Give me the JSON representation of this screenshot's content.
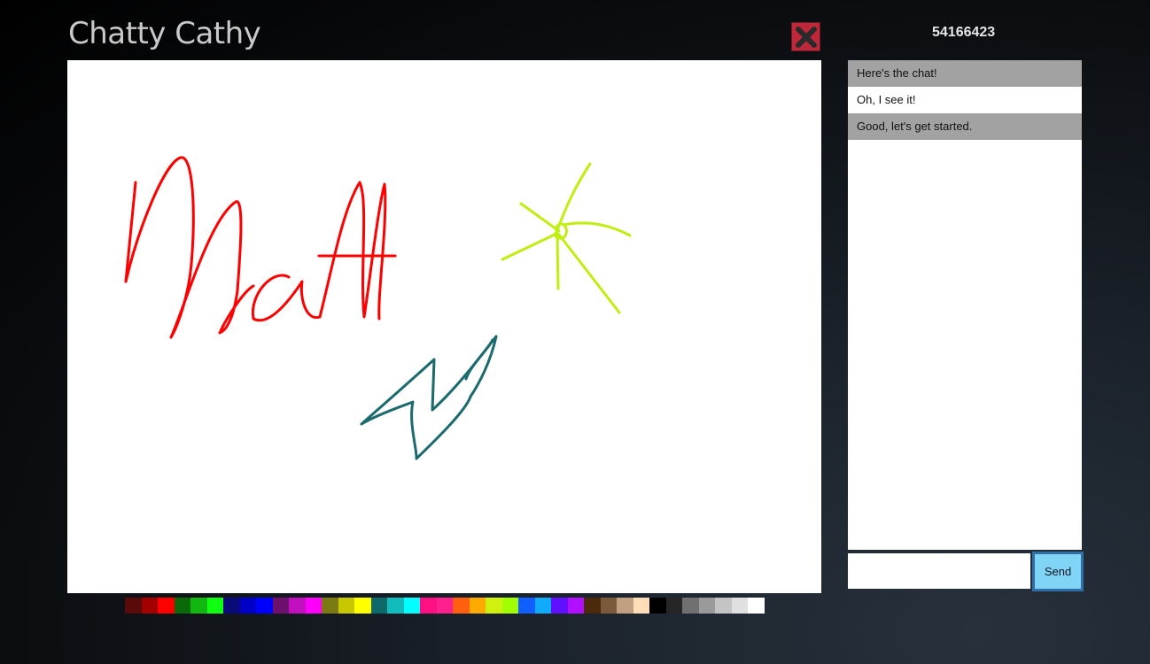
{
  "app": {
    "title": "Chatty Cathy",
    "room_id": "54166423"
  },
  "toolbar": {
    "close_icon": "close-x-icon"
  },
  "chat": {
    "messages": [
      {
        "text": "Here's the chat!",
        "shaded": true
      },
      {
        "text": "Oh, I see it!",
        "shaded": false
      },
      {
        "text": "Good, let's get started.",
        "shaded": true
      }
    ],
    "input_value": "",
    "send_label": "Send"
  },
  "palette": {
    "colors": [
      "#5a0a0a",
      "#a30000",
      "#ff0000",
      "#0a6a0a",
      "#10b810",
      "#10ff10",
      "#0a0a78",
      "#0000c8",
      "#0000ff",
      "#6e116e",
      "#c010c0",
      "#ff00ff",
      "#7a7a10",
      "#c8c800",
      "#ffff00",
      "#0e6a6a",
      "#10bcbc",
      "#00ffff",
      "#ff1080",
      "#ff2090",
      "#ff6010",
      "#ffaa00",
      "#d0f010",
      "#a0ff00",
      "#1060ff",
      "#10aaff",
      "#6010ff",
      "#b010ff",
      "#4a2a0a",
      "#7a5a3a",
      "#c0a080",
      "#ffdcb8",
      "#000000",
      "#262626",
      "#707070",
      "#9a9a9a",
      "#c4c4c4",
      "#e0e0e0",
      "#ffffff"
    ]
  },
  "drawing": {
    "stroke_colors": {
      "signature": "#ff0000",
      "sun": "#bfee10",
      "bolt": "#1a6a6e"
    }
  }
}
